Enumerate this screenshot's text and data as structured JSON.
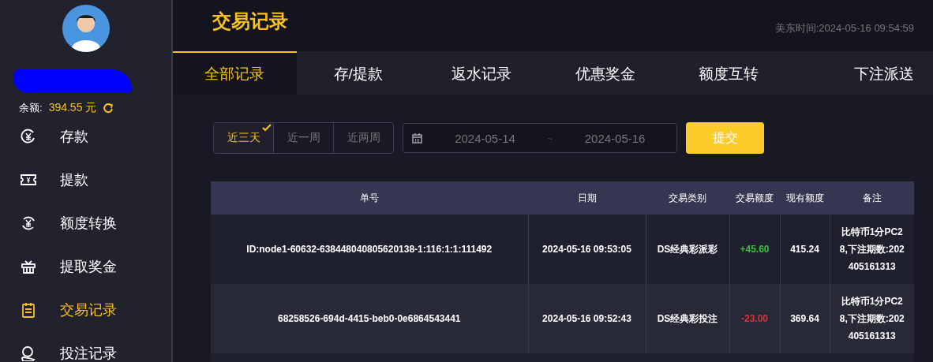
{
  "sidebar": {
    "balance_label": "余额:",
    "balance_value": "394.55 元",
    "items": [
      {
        "label": "存款",
        "selected": false
      },
      {
        "label": "提款",
        "selected": false
      },
      {
        "label": "额度转换",
        "selected": false
      },
      {
        "label": "提取奖金",
        "selected": false
      },
      {
        "label": "交易记录",
        "selected": true
      },
      {
        "label": "投注记录",
        "selected": false
      }
    ]
  },
  "header": {
    "title": "交易记录",
    "clock": "美东时间:2024-05-16 09:54:59"
  },
  "tabs": [
    {
      "label": "全部记录",
      "selected": true
    },
    {
      "label": "存/提款",
      "selected": false
    },
    {
      "label": "返水记录",
      "selected": false
    },
    {
      "label": "优惠奖金",
      "selected": false
    },
    {
      "label": "额度互转",
      "selected": false
    },
    {
      "label": "下注派送",
      "selected": false
    }
  ],
  "filters": {
    "ranges": [
      {
        "label": "近三天",
        "selected": true
      },
      {
        "label": "近一周",
        "selected": false
      },
      {
        "label": "近两周",
        "selected": false
      }
    ],
    "start_date": "2024-05-14",
    "separator": "~",
    "end_date": "2024-05-16",
    "submit": "提交"
  },
  "table": {
    "columns": [
      "单号",
      "日期",
      "交易类别",
      "交易额度",
      "现有额度",
      "备注"
    ],
    "rows": [
      {
        "kind": "credit",
        "cells": [
          "ID:node1-60632-638448040805620138-1:116:1:1:111492",
          "2024-05-16 09:53:05",
          "DS经典彩派彩",
          "+45.60",
          "415.24",
          "比特币1分PC28,下注期数:202405161313"
        ]
      },
      {
        "kind": "debit",
        "cells": [
          "68258526-694d-4415-beb0-0e6864543441",
          "2024-05-16 09:52:43",
          "DS经典彩投注",
          "-23.00",
          "369.64",
          "比特币1分PC28,下注期数:202405161313"
        ]
      }
    ]
  }
}
